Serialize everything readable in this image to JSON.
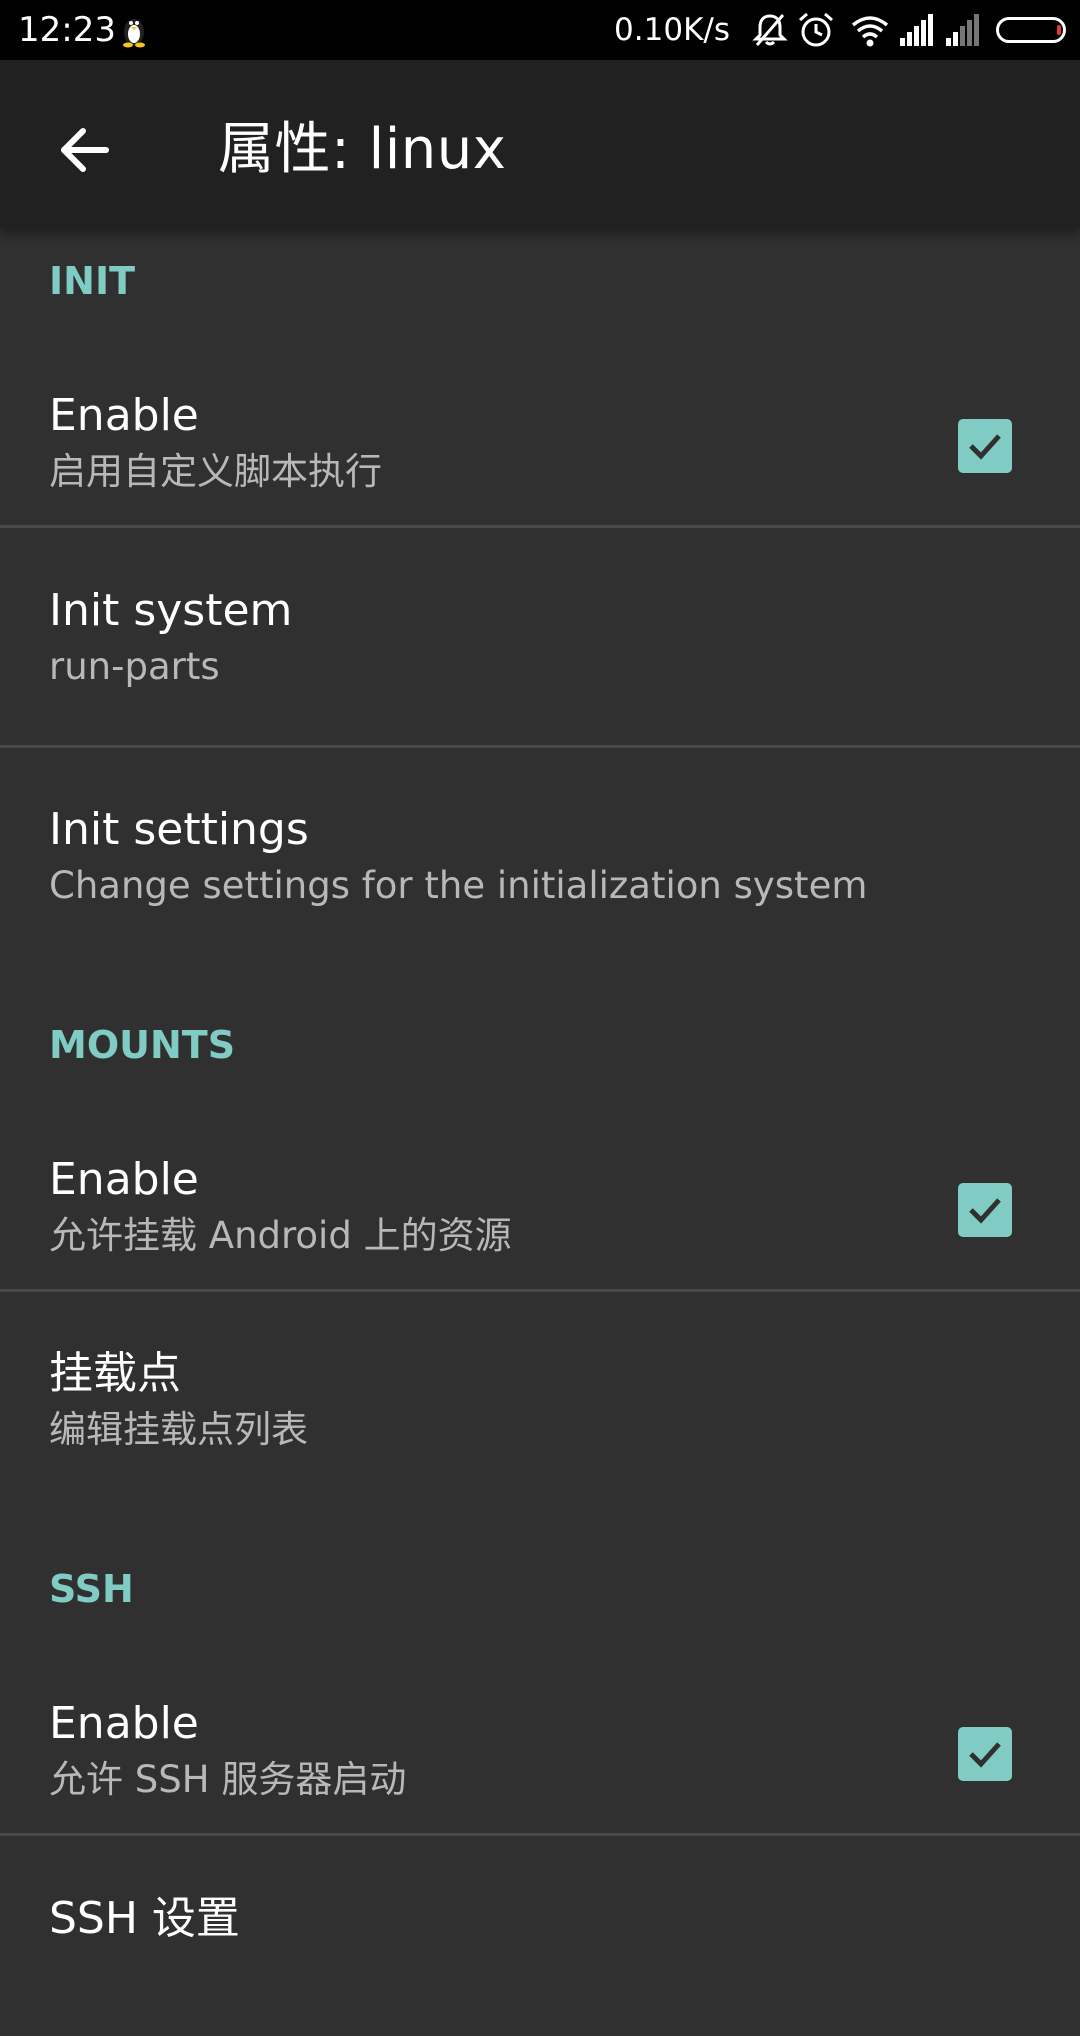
{
  "status_bar": {
    "time": "12:23",
    "left_icon": "penguin-icon",
    "network_speed": "0.10K/s",
    "icons": [
      "bell-off-icon",
      "alarm-icon",
      "wifi-icon",
      "signal-icon",
      "signal-weak-icon",
      "battery-icon"
    ],
    "battery_level": 0.05
  },
  "appbar": {
    "back_icon": "arrow-back-icon",
    "title": "属性: linux"
  },
  "sections": [
    {
      "header": "INIT",
      "items": [
        {
          "title": "Enable",
          "summary": "启用自定义脚本执行",
          "checked": true
        },
        {
          "title": "Init system",
          "summary": "run-parts"
        },
        {
          "title": "Init settings",
          "summary": "Change settings for the initialization system"
        }
      ]
    },
    {
      "header": "MOUNTS",
      "items": [
        {
          "title": "Enable",
          "summary": "允许挂载 Android 上的资源",
          "checked": true
        },
        {
          "title": "挂载点",
          "summary": "编辑挂载点列表"
        }
      ]
    },
    {
      "header": "SSH",
      "items": [
        {
          "title": "Enable",
          "summary": "允许 SSH 服务器启动",
          "checked": true
        },
        {
          "title": "SSH 设置",
          "summary": ""
        }
      ]
    }
  ],
  "colors": {
    "accent": "#80cbc4",
    "background": "#303030",
    "appbar": "#212121",
    "statusbar": "#000000"
  }
}
